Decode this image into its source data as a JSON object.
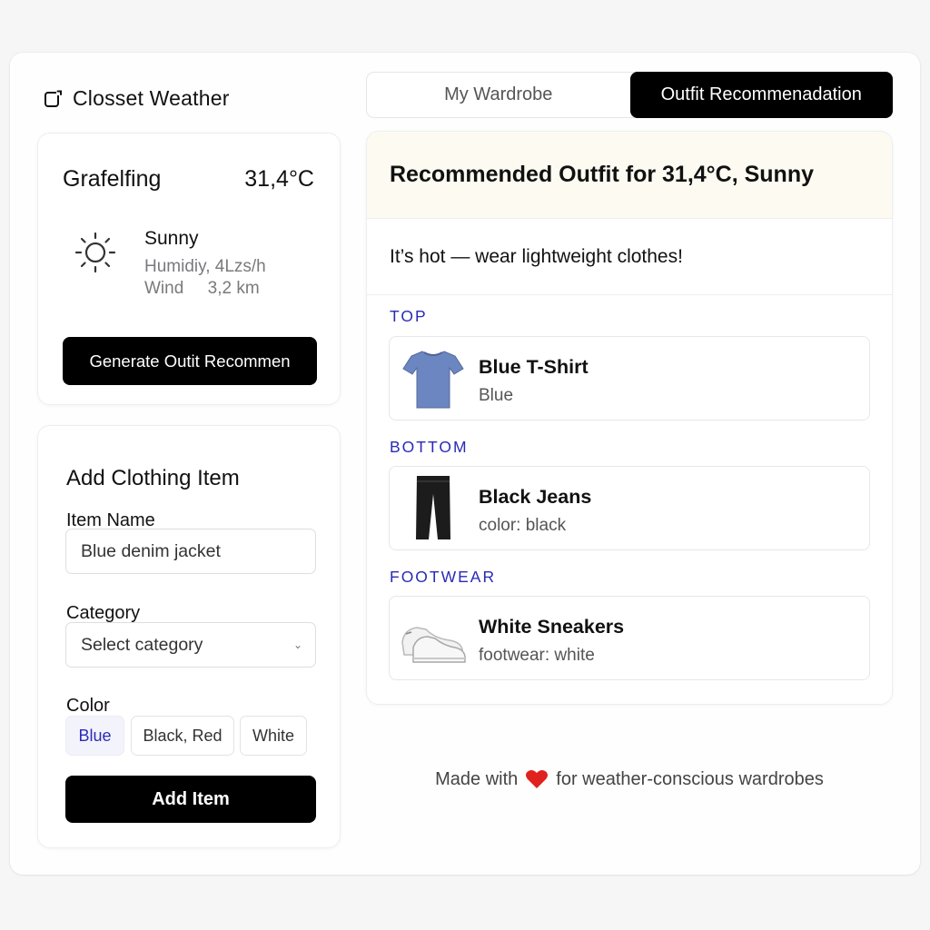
{
  "app": {
    "title": "Closset Weather"
  },
  "tabs": [
    {
      "label": "My Wardrobe",
      "active": false
    },
    {
      "label": "Outfit Recommenadation",
      "active": true
    }
  ],
  "weather": {
    "city": "Grafelfing",
    "temperature": "31,4°C",
    "condition": "Sunny",
    "humidity_line": "Humidiy, 4Lzs/h",
    "wind_line": "Wind     3,2 km",
    "icon": "sun-icon",
    "button_label": "Generate Outit Recommen"
  },
  "add_item": {
    "title": "Add Clothing Item",
    "name_label": "Item Name",
    "name_value": "Blue denim jacket",
    "category_label": "Category",
    "category_value": "Select category",
    "color_label": "Color",
    "color_options": [
      {
        "label": "Blue",
        "selected": true
      },
      {
        "label": "Black, Red",
        "selected": false
      },
      {
        "label": "White",
        "selected": false
      }
    ],
    "button_label": "Add Item"
  },
  "outfit": {
    "heading": "Recommended Outfit for 31,4°C, Sunny",
    "message": "It’s hot — wear lightweight clothes!",
    "sections": [
      {
        "label": "TOP",
        "item_name": "Blue T-Shirt",
        "item_detail": "Blue",
        "icon": "tshirt-icon",
        "color": "#6b86c0"
      },
      {
        "label": "BOTTOM",
        "item_name": "Black Jeans",
        "item_detail": "color: black",
        "icon": "jeans-icon",
        "color": "#1c1c1c"
      },
      {
        "label": "FOOTWEAR",
        "item_name": "White Sneakers",
        "item_detail": "footwear: white",
        "icon": "sneakers-icon",
        "color": "#f2f2f2"
      }
    ]
  },
  "footer": {
    "prefix": "Made with",
    "suffix": "for weather-conscious wardrobes",
    "icon": "heart-icon"
  },
  "colors": {
    "accent_dark": "#000000",
    "section_label": "#2a2ab5",
    "header_tint": "#fdfbf1",
    "heart": "#e0221f"
  }
}
